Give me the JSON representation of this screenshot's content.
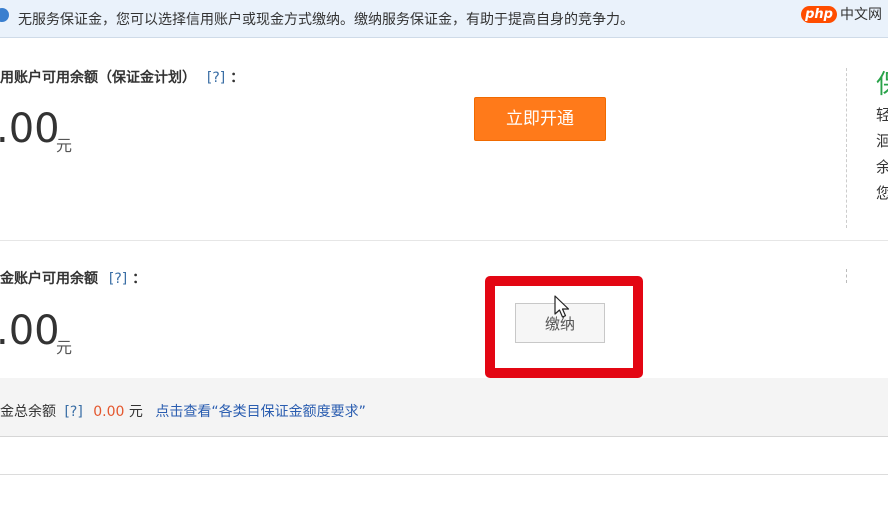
{
  "notice": {
    "text": "无服务保证金，您可以选择信用账户或现金方式缴纳。缴纳服务保证金，有助于提高自身的竞争力。"
  },
  "watermark": {
    "logo": "php",
    "site": "中文网"
  },
  "credit_section": {
    "label": "用账户可用余额（保证金计划）",
    "help": "[?]",
    "colon": "：",
    "amount": ".00",
    "unit": "元",
    "open_button": "立即开通",
    "side_glyphs": [
      "保",
      "轻",
      "洄",
      "余",
      "您"
    ]
  },
  "cash_section": {
    "label": "金账户可用余额",
    "help": "[?]",
    "colon": "：",
    "amount": ".00",
    "unit": "元",
    "pay_button": "缴纳"
  },
  "total_section": {
    "label": "金总余额",
    "help": "[?]",
    "value": "0.00",
    "unit": "元",
    "link": "点击查看“各类目保证金额度要求”"
  }
}
